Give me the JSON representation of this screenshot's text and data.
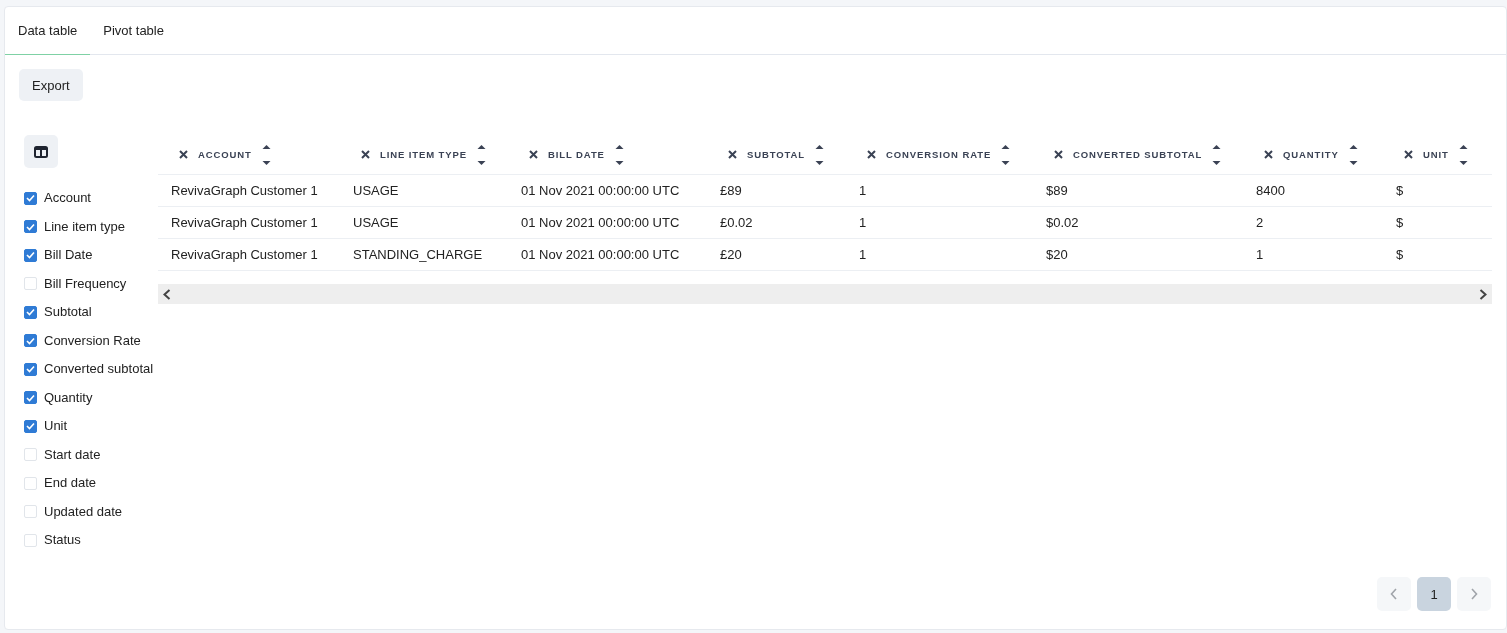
{
  "tabs": [
    {
      "label": "Data table",
      "selected": true
    },
    {
      "label": "Pivot table",
      "selected": false
    }
  ],
  "export_button": "Export",
  "column_picker": [
    {
      "label": "Account",
      "checked": true
    },
    {
      "label": "Line item type",
      "checked": true
    },
    {
      "label": "Bill Date",
      "checked": true
    },
    {
      "label": "Bill Frequency",
      "checked": false
    },
    {
      "label": "Subtotal",
      "checked": true
    },
    {
      "label": "Conversion Rate",
      "checked": true
    },
    {
      "label": "Converted subtotal",
      "checked": true
    },
    {
      "label": "Quantity",
      "checked": true
    },
    {
      "label": "Unit",
      "checked": true
    },
    {
      "label": "Start date",
      "checked": false
    },
    {
      "label": "End date",
      "checked": false
    },
    {
      "label": "Updated date",
      "checked": false
    },
    {
      "label": "Status",
      "checked": false
    }
  ],
  "table": {
    "columns": [
      "ACCOUNT",
      "LINE ITEM TYPE",
      "BILL DATE",
      "SUBTOTAL",
      "CONVERSION RATE",
      "CONVERTED SUBTOTAL",
      "QUANTITY",
      "UNIT"
    ],
    "rows": [
      [
        "RevivaGraph Customer 1",
        "USAGE",
        "01 Nov 2021 00:00:00 UTC",
        "£89",
        "1",
        "$89",
        "8400",
        "$"
      ],
      [
        "RevivaGraph Customer 1",
        "USAGE",
        "01 Nov 2021 00:00:00 UTC",
        "£0.02",
        "1",
        "$0.02",
        "2",
        "$"
      ],
      [
        "RevivaGraph Customer 1",
        "STANDING_CHARGE",
        "01 Nov 2021 00:00:00 UTC",
        "£20",
        "1",
        "$20",
        "1",
        "$"
      ]
    ]
  },
  "pagination": {
    "prev_disabled": true,
    "next_disabled": true,
    "pages": [
      {
        "label": "1",
        "selected": true
      }
    ]
  }
}
